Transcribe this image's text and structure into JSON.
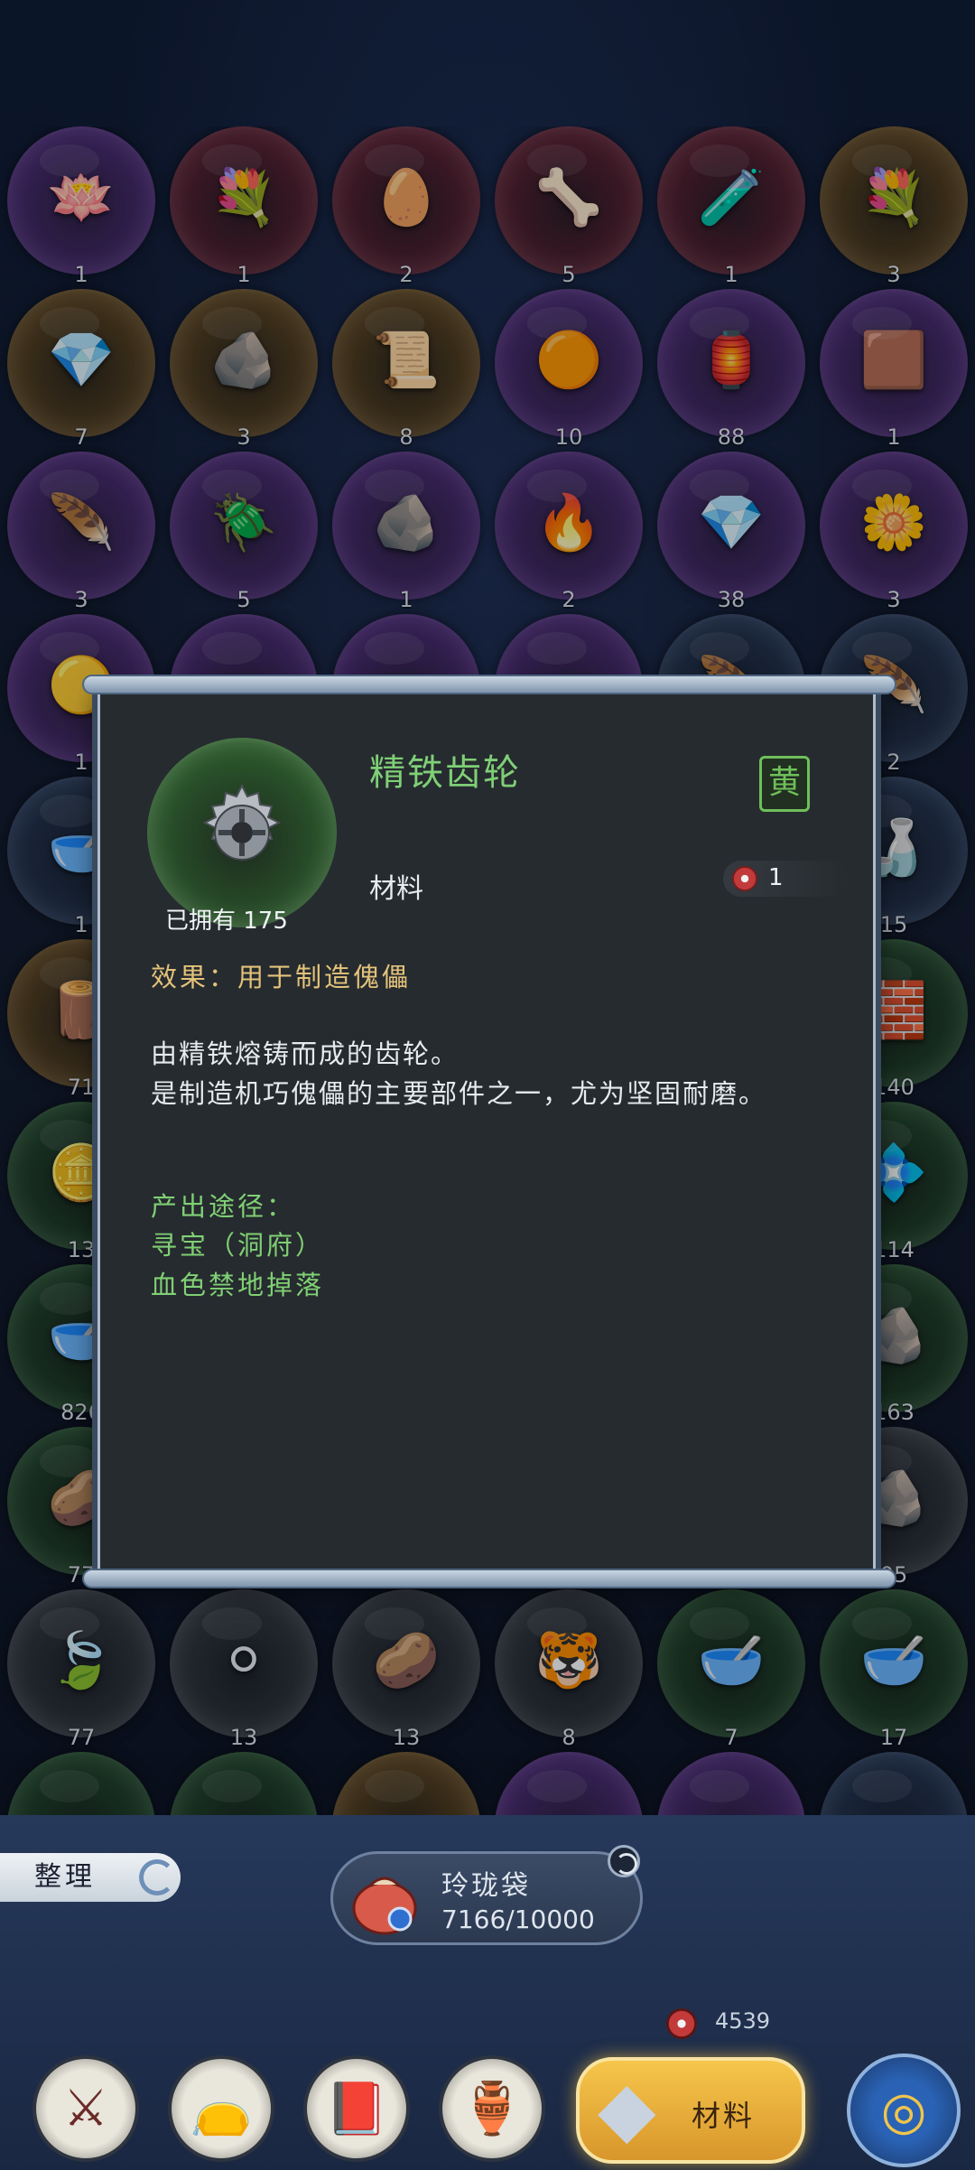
{
  "grid": {
    "rows": [
      [
        {
          "count": "1",
          "icon": "lotus-icon",
          "glyph": "🪷",
          "rim": "purple"
        },
        {
          "count": "1",
          "icon": "flower-bell-icon",
          "glyph": "💐",
          "rim": "red"
        },
        {
          "count": "2",
          "icon": "fire-egg-icon",
          "glyph": "🥚",
          "rim": "red"
        },
        {
          "count": "5",
          "icon": "bone-icon",
          "glyph": "🦴",
          "rim": "red"
        },
        {
          "count": "1",
          "icon": "potion-icon",
          "glyph": "🧪",
          "rim": "red"
        },
        {
          "count": "3",
          "icon": "flower-bell-icon",
          "glyph": "💐",
          "rim": "gold"
        }
      ],
      [
        {
          "count": "7",
          "icon": "purple-crystal-icon",
          "glyph": "💎",
          "rim": "gold"
        },
        {
          "count": "3",
          "icon": "coal-icon",
          "glyph": "🪨",
          "rim": "gold"
        },
        {
          "count": "8",
          "icon": "scroll-icon",
          "glyph": "📜",
          "rim": "gold"
        },
        {
          "count": "10",
          "icon": "golden-pearl-icon",
          "glyph": "🟠",
          "rim": "purple"
        },
        {
          "count": "88",
          "icon": "lantern-icon",
          "glyph": "🏮",
          "rim": "purple"
        },
        {
          "count": "1",
          "icon": "copper-cube-icon",
          "glyph": "🟫",
          "rim": "purple"
        }
      ],
      [
        {
          "count": "3",
          "icon": "feather-icon",
          "glyph": "🪶",
          "rim": "purple"
        },
        {
          "count": "5",
          "icon": "beetle-icon",
          "glyph": "🪲",
          "rim": "purple"
        },
        {
          "count": "1",
          "icon": "ore-icon",
          "glyph": "🪨",
          "rim": "purple"
        },
        {
          "count": "2",
          "icon": "flame-orb-icon",
          "glyph": "🔥",
          "rim": "purple"
        },
        {
          "count": "38",
          "icon": "purple-crystal-icon",
          "glyph": "💎",
          "rim": "purple"
        },
        {
          "count": "3",
          "icon": "golden-flower-icon",
          "glyph": "🌼",
          "rim": "purple"
        }
      ],
      [
        {
          "count": "1",
          "icon": "amber-icon",
          "glyph": "🟡",
          "rim": "purple"
        },
        {
          "count": "",
          "icon": "hidden-item-icon",
          "glyph": "",
          "rim": "purple"
        },
        {
          "count": "",
          "icon": "hidden-item-icon",
          "glyph": "",
          "rim": "purple"
        },
        {
          "count": "",
          "icon": "hidden-item-icon",
          "glyph": "",
          "rim": "purple"
        },
        {
          "count": "",
          "icon": "feather-icon",
          "glyph": "🪶",
          "rim": "blue"
        },
        {
          "count": "2",
          "icon": "feather-icon",
          "glyph": "🪶",
          "rim": "blue"
        }
      ],
      [
        {
          "count": "1",
          "icon": "blood-bowl-icon",
          "glyph": "🥣",
          "rim": "blue"
        },
        {
          "count": "",
          "icon": "hidden-item-icon",
          "glyph": "",
          "rim": "blue"
        },
        {
          "count": "",
          "icon": "hidden-item-icon",
          "glyph": "",
          "rim": "blue"
        },
        {
          "count": "",
          "icon": "hidden-item-icon",
          "glyph": "",
          "rim": "blue"
        },
        {
          "count": "",
          "icon": "hidden-item-icon",
          "glyph": "",
          "rim": "blue"
        },
        {
          "count": "15",
          "icon": "oil-bottle-icon",
          "glyph": "🍶",
          "rim": "blue"
        }
      ],
      [
        {
          "count": "71",
          "icon": "branch-icon",
          "glyph": "🪵",
          "rim": "gold"
        },
        {
          "count": "",
          "icon": "hidden-item-icon",
          "glyph": "",
          "rim": "gold"
        },
        {
          "count": "",
          "icon": "hidden-item-icon",
          "glyph": "",
          "rim": "gold"
        },
        {
          "count": "",
          "icon": "hidden-item-icon",
          "glyph": "",
          "rim": "gold"
        },
        {
          "count": "",
          "icon": "hidden-item-icon",
          "glyph": "",
          "rim": "gold"
        },
        {
          "count": "140",
          "icon": "iron-ingot-icon",
          "glyph": "🧱",
          "rim": "green"
        }
      ],
      [
        {
          "count": "13",
          "icon": "gold-ore-icon",
          "glyph": "🪙",
          "rim": "green"
        },
        {
          "count": "",
          "icon": "hidden-item-icon",
          "glyph": "",
          "rim": "green"
        },
        {
          "count": "",
          "icon": "hidden-item-icon",
          "glyph": "",
          "rim": "green"
        },
        {
          "count": "",
          "icon": "hidden-item-icon",
          "glyph": "",
          "rim": "green"
        },
        {
          "count": "",
          "icon": "hidden-item-icon",
          "glyph": "",
          "rim": "green"
        },
        {
          "count": "114",
          "icon": "jade-crystal-icon",
          "glyph": "💠",
          "rim": "green"
        }
      ],
      [
        {
          "count": "826",
          "icon": "blood-bowl-icon",
          "glyph": "🥣",
          "rim": "green"
        },
        {
          "count": "",
          "icon": "hidden-item-icon",
          "glyph": "",
          "rim": "green"
        },
        {
          "count": "",
          "icon": "hidden-item-icon",
          "glyph": "",
          "rim": "green"
        },
        {
          "count": "",
          "icon": "hidden-item-icon",
          "glyph": "",
          "rim": "green"
        },
        {
          "count": "",
          "icon": "hidden-item-icon",
          "glyph": "",
          "rim": "green"
        },
        {
          "count": "163",
          "icon": "silver-ore-icon",
          "glyph": "🪨",
          "rim": "green"
        }
      ],
      [
        {
          "count": "77",
          "icon": "seed-icon",
          "glyph": "🥔",
          "rim": "green"
        },
        {
          "count": "",
          "icon": "hidden-item-icon",
          "glyph": "",
          "rim": "grey"
        },
        {
          "count": "",
          "icon": "hidden-item-icon",
          "glyph": "",
          "rim": "grey"
        },
        {
          "count": "",
          "icon": "hidden-item-icon",
          "glyph": "",
          "rim": "grey"
        },
        {
          "count": "",
          "icon": "hidden-item-icon",
          "glyph": "",
          "rim": "grey"
        },
        {
          "count": "05",
          "icon": "quartz-icon",
          "glyph": "🪨",
          "rim": "grey"
        }
      ],
      [
        {
          "count": "77",
          "icon": "leaf-icon",
          "glyph": "🍃",
          "rim": "grey"
        },
        {
          "count": "13",
          "icon": "white-stones-icon",
          "glyph": "⚪",
          "rim": "grey"
        },
        {
          "count": "13",
          "icon": "seed-icon",
          "glyph": "🥔",
          "rim": "grey"
        },
        {
          "count": "8",
          "icon": "tiger-pelt-icon",
          "glyph": "🐯",
          "rim": "grey"
        },
        {
          "count": "7",
          "icon": "red-powder-icon",
          "glyph": "🥣",
          "rim": "green"
        },
        {
          "count": "17",
          "icon": "red-powder-icon",
          "glyph": "🥣",
          "rim": "green"
        }
      ],
      [
        {
          "count": "",
          "icon": "hidden-item-icon",
          "glyph": "",
          "rim": "green"
        },
        {
          "count": "",
          "icon": "hidden-item-icon",
          "glyph": "",
          "rim": "green"
        },
        {
          "count": "",
          "icon": "hidden-item-icon",
          "glyph": "",
          "rim": "gold"
        },
        {
          "count": "",
          "icon": "hidden-item-icon",
          "glyph": "",
          "rim": "purple"
        },
        {
          "count": "",
          "icon": "hidden-item-icon",
          "glyph": "",
          "rim": "purple"
        },
        {
          "count": "",
          "icon": "hidden-item-icon",
          "glyph": "",
          "rim": "blue"
        }
      ]
    ]
  },
  "detail": {
    "name": "精铁齿轮",
    "grade": "黄",
    "category": "材料",
    "price": "1",
    "owned": "已拥有 175",
    "effect": "效果：用于制造傀儡",
    "description_1": "由精铁熔铸而成的齿轮。",
    "description_2": "是制造机巧傀儡的主要部件之一，尤为坚固耐磨。",
    "source_title": "产出途径：",
    "source_1": "寻宝（洞府）",
    "source_2": "血色禁地掉落",
    "icon": "gear-icon",
    "rim_color": "#6bbf4f"
  },
  "toolbar": {
    "sort_label": "整理",
    "bag_title": "玲珑袋",
    "bag_capacity": "7166/10000",
    "currency": "4539"
  },
  "nav": {
    "tabs": [
      {
        "name": "nav-equipment",
        "icon": "sword-icon",
        "glyph": "⚔"
      },
      {
        "name": "nav-consumables",
        "icon": "pouch-icon",
        "glyph": "👝"
      },
      {
        "name": "nav-books",
        "icon": "book-icon",
        "glyph": "📕"
      },
      {
        "name": "nav-elixirs",
        "icon": "gourd-icon",
        "glyph": "🏺"
      }
    ],
    "active_label": "材料",
    "active_icon": "crystal-icon",
    "right_icon": "swirl-icon"
  },
  "colors": {
    "accent_green": "#7fcf76",
    "effect_gold": "#e3c27a",
    "active_tab": "#f6c64b"
  }
}
